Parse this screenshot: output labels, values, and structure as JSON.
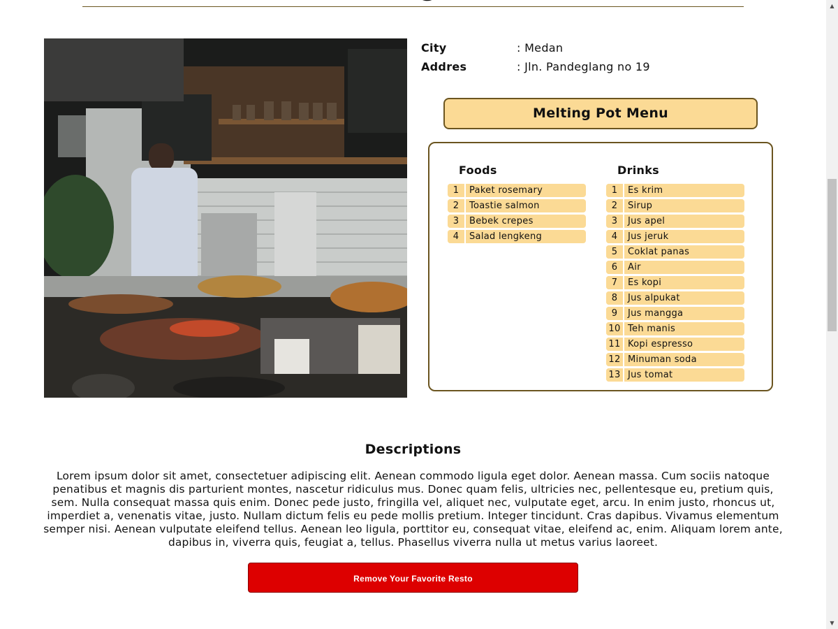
{
  "page": {
    "title": "Melting Pot"
  },
  "restaurant": {
    "city_label": "City",
    "city_value": ": Medan",
    "address_label": "Addres",
    "address_value": ": Jln. Pandeglang no 19"
  },
  "menu": {
    "title": "Melting Pot Menu",
    "foods_title": "Foods",
    "drinks_title": "Drinks",
    "foods": [
      {
        "num": "1",
        "name": "Paket rosemary"
      },
      {
        "num": "2",
        "name": "Toastie salmon"
      },
      {
        "num": "3",
        "name": "Bebek crepes"
      },
      {
        "num": "4",
        "name": "Salad lengkeng"
      }
    ],
    "drinks": [
      {
        "num": "1",
        "name": "Es krim"
      },
      {
        "num": "2",
        "name": "Sirup"
      },
      {
        "num": "3",
        "name": "Jus apel"
      },
      {
        "num": "4",
        "name": "Jus jeruk"
      },
      {
        "num": "5",
        "name": "Coklat panas"
      },
      {
        "num": "6",
        "name": "Air"
      },
      {
        "num": "7",
        "name": "Es kopi"
      },
      {
        "num": "8",
        "name": "Jus alpukat"
      },
      {
        "num": "9",
        "name": "Jus mangga"
      },
      {
        "num": "10",
        "name": "Teh manis"
      },
      {
        "num": "11",
        "name": "Kopi espresso"
      },
      {
        "num": "12",
        "name": "Minuman soda"
      },
      {
        "num": "13",
        "name": "Jus tomat"
      }
    ]
  },
  "description": {
    "title": "Descriptions",
    "text": "Lorem ipsum dolor sit amet, consectetuer adipiscing elit. Aenean commodo ligula eget dolor. Aenean massa. Cum sociis natoque penatibus et magnis dis parturient montes, nascetur ridiculus mus. Donec quam felis, ultricies nec, pellentesque eu, pretium quis, sem. Nulla consequat massa quis enim. Donec pede justo, fringilla vel, aliquet nec, vulputate eget, arcu. In enim justo, rhoncus ut, imperdiet a, venenatis vitae, justo. Nullam dictum felis eu pede mollis pretium. Integer tincidunt. Cras dapibus. Vivamus elementum semper nisi. Aenean vulputate eleifend tellus. Aenean leo ligula, porttitor eu, consequat vitae, eleifend ac, enim. Aliquam lorem ante, dapibus in, viverra quis, feugiat a, tellus. Phasellus viverra nulla ut metus varius laoreet."
  },
  "actions": {
    "remove_favorite_label": "Remove Your Favorite Resto"
  },
  "colors": {
    "accent": "#fbda95",
    "border": "#6b5520",
    "danger": "#dd0000"
  },
  "icons": {
    "scroll_up": "scroll-up-arrow-icon",
    "scroll_down": "scroll-down-arrow-icon"
  }
}
